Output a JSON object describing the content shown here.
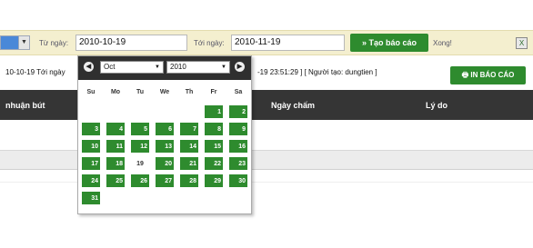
{
  "toolbar": {
    "from_label": "Từ ngày:",
    "from_value": "2010-10-19",
    "to_label": "Tới ngày:",
    "to_value": "2010-11-19",
    "create_button": "» Tạo báo cáo",
    "status": "Xong!",
    "accent": "#2e8b2e"
  },
  "info": {
    "left_text": "10-10-19 Tới ngày",
    "right_text": "-19 23:51:29 ] [ Người tạo: dungtien ]",
    "print_button": "🖶 IN BÁO CÁO"
  },
  "table": {
    "headers": [
      "nhuận bút",
      "Ngày chấm",
      "Lý do"
    ]
  },
  "calendar": {
    "prev": "◀",
    "next": "▶",
    "month": "Oct",
    "year": "2010",
    "weekdays": [
      "Su",
      "Mo",
      "Tu",
      "We",
      "Th",
      "Fr",
      "Sa"
    ],
    "days": [
      "1",
      "2",
      "3",
      "4",
      "5",
      "6",
      "7",
      "8",
      "9",
      "10",
      "11",
      "12",
      "13",
      "14",
      "15",
      "16",
      "17",
      "18",
      "19",
      "20",
      "21",
      "22",
      "23",
      "24",
      "25",
      "26",
      "27",
      "28",
      "29",
      "30",
      "31"
    ],
    "first_weekday": 5,
    "today": "19",
    "day_color": "#2e8b2e"
  }
}
